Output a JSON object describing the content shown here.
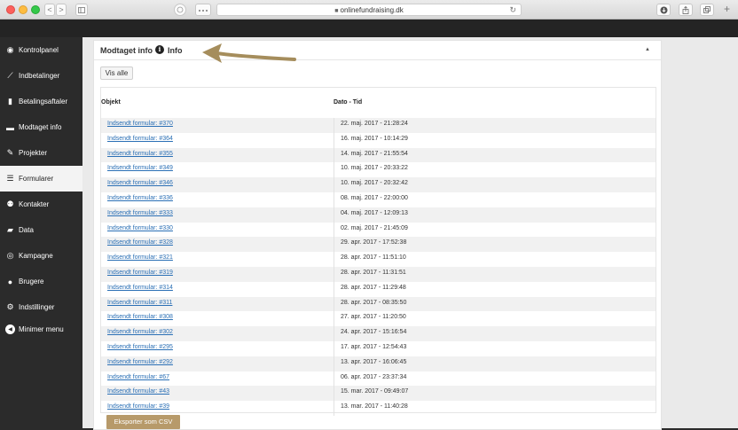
{
  "browser": {
    "url": "onlinefundraising.dk",
    "back": "<",
    "forward": ">"
  },
  "sidebar": {
    "items": [
      {
        "label": "Kontrolpanel",
        "icon": "dashboard-icon",
        "glyph": "◉"
      },
      {
        "label": "Indbetalinger",
        "icon": "line-chart-icon",
        "glyph": "⟋"
      },
      {
        "label": "Betalingsaftaler",
        "icon": "bar-chart-icon",
        "glyph": "▮"
      },
      {
        "label": "Modtaget info",
        "icon": "comment-icon",
        "glyph": "▬"
      },
      {
        "label": "Projekter",
        "icon": "pencil-icon",
        "glyph": "✎"
      },
      {
        "label": "Formularer",
        "icon": "list-icon",
        "glyph": "☰"
      },
      {
        "label": "Kontakter",
        "icon": "users-icon",
        "glyph": "⚉"
      },
      {
        "label": "Data",
        "icon": "folder-icon",
        "glyph": "▰"
      },
      {
        "label": "Kampagne",
        "icon": "target-icon",
        "glyph": "◎"
      },
      {
        "label": "Brugere",
        "icon": "user-icon",
        "glyph": "●"
      },
      {
        "label": "Indstillinger",
        "icon": "gear-icon",
        "glyph": "⚙"
      },
      {
        "label": "Minimer menu",
        "icon": "collapse-menu-icon",
        "glyph": "◀"
      }
    ],
    "active_index": 5
  },
  "panel": {
    "title": "Modtaget info",
    "info_label": "Info",
    "vis_alle": "Vis alle",
    "columns": [
      "Objekt",
      "Dato - Tid"
    ],
    "rows": [
      [
        "Indsendt formular: #370",
        "22. maj. 2017 - 21:28:24"
      ],
      [
        "Indsendt formular: #364",
        "16. maj. 2017 - 10:14:29"
      ],
      [
        "Indsendt formular: #355",
        "14. maj. 2017 - 21:55:54"
      ],
      [
        "Indsendt formular: #349",
        "10. maj. 2017 - 20:33:22"
      ],
      [
        "Indsendt formular: #346",
        "10. maj. 2017 - 20:32:42"
      ],
      [
        "Indsendt formular: #336",
        "08. maj. 2017 - 22:00:00"
      ],
      [
        "Indsendt formular: #333",
        "04. maj. 2017 - 12:09:13"
      ],
      [
        "Indsendt formular: #330",
        "02. maj. 2017 - 21:45:09"
      ],
      [
        "Indsendt formular: #328",
        "29. apr. 2017 - 17:52:38"
      ],
      [
        "Indsendt formular: #321",
        "28. apr. 2017 - 11:51:10"
      ],
      [
        "Indsendt formular: #319",
        "28. apr. 2017 - 11:31:51"
      ],
      [
        "Indsendt formular: #314",
        "28. apr. 2017 - 11:29:48"
      ],
      [
        "Indsendt formular: #311",
        "28. apr. 2017 - 08:35:50"
      ],
      [
        "Indsendt formular: #308",
        "27. apr. 2017 - 11:20:50"
      ],
      [
        "Indsendt formular: #302",
        "24. apr. 2017 - 15:16:54"
      ],
      [
        "Indsendt formular: #295",
        "17. apr. 2017 - 12:54:43"
      ],
      [
        "Indsendt formular: #292",
        "13. apr. 2017 - 16:06:45"
      ],
      [
        "Indsendt formular: #67",
        "06. apr. 2017 - 23:37:34"
      ],
      [
        "Indsendt formular: #43",
        "15. mar. 2017 - 09:49:07"
      ],
      [
        "Indsendt formular: #39",
        "13. mar. 2017 - 11:40:28"
      ]
    ],
    "export_button": "Eksporter som CSV"
  },
  "colors": {
    "accent": "#b79a6a",
    "link": "#2a6fb5",
    "sidebar_bg": "#2b2b2b"
  }
}
